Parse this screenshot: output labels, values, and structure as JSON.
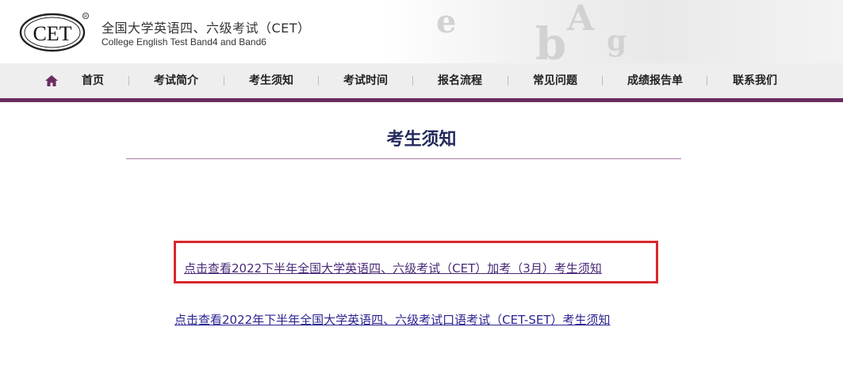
{
  "header": {
    "logo_text": "CET",
    "brand_cn": "全国大学英语四、六级考试（CET）",
    "brand_en": "College English Test Band4 and Band6"
  },
  "nav": {
    "items": [
      {
        "label": "首页"
      },
      {
        "label": "考试简介"
      },
      {
        "label": "考生须知"
      },
      {
        "label": "考试时间"
      },
      {
        "label": "报名流程"
      },
      {
        "label": "常见问题"
      },
      {
        "label": "成绩报告单"
      },
      {
        "label": "联系我们"
      }
    ]
  },
  "main": {
    "title": "考生须知",
    "links": [
      {
        "label": "点击查看2022下半年全国大学英语四、六级考试（CET）加考（3月）考生须知",
        "highlighted": true
      },
      {
        "label": "点击查看2022年下半年全国大学英语四、六级考试口语考试（CET-SET）考生须知",
        "highlighted": false
      }
    ]
  },
  "colors": {
    "accent": "#6a2c5e",
    "title": "#242a5c",
    "link": "#2a2590",
    "highlight_border": "#d9262c",
    "nav_bg": "#eeeeee"
  },
  "icons": {
    "home": "home-icon"
  }
}
